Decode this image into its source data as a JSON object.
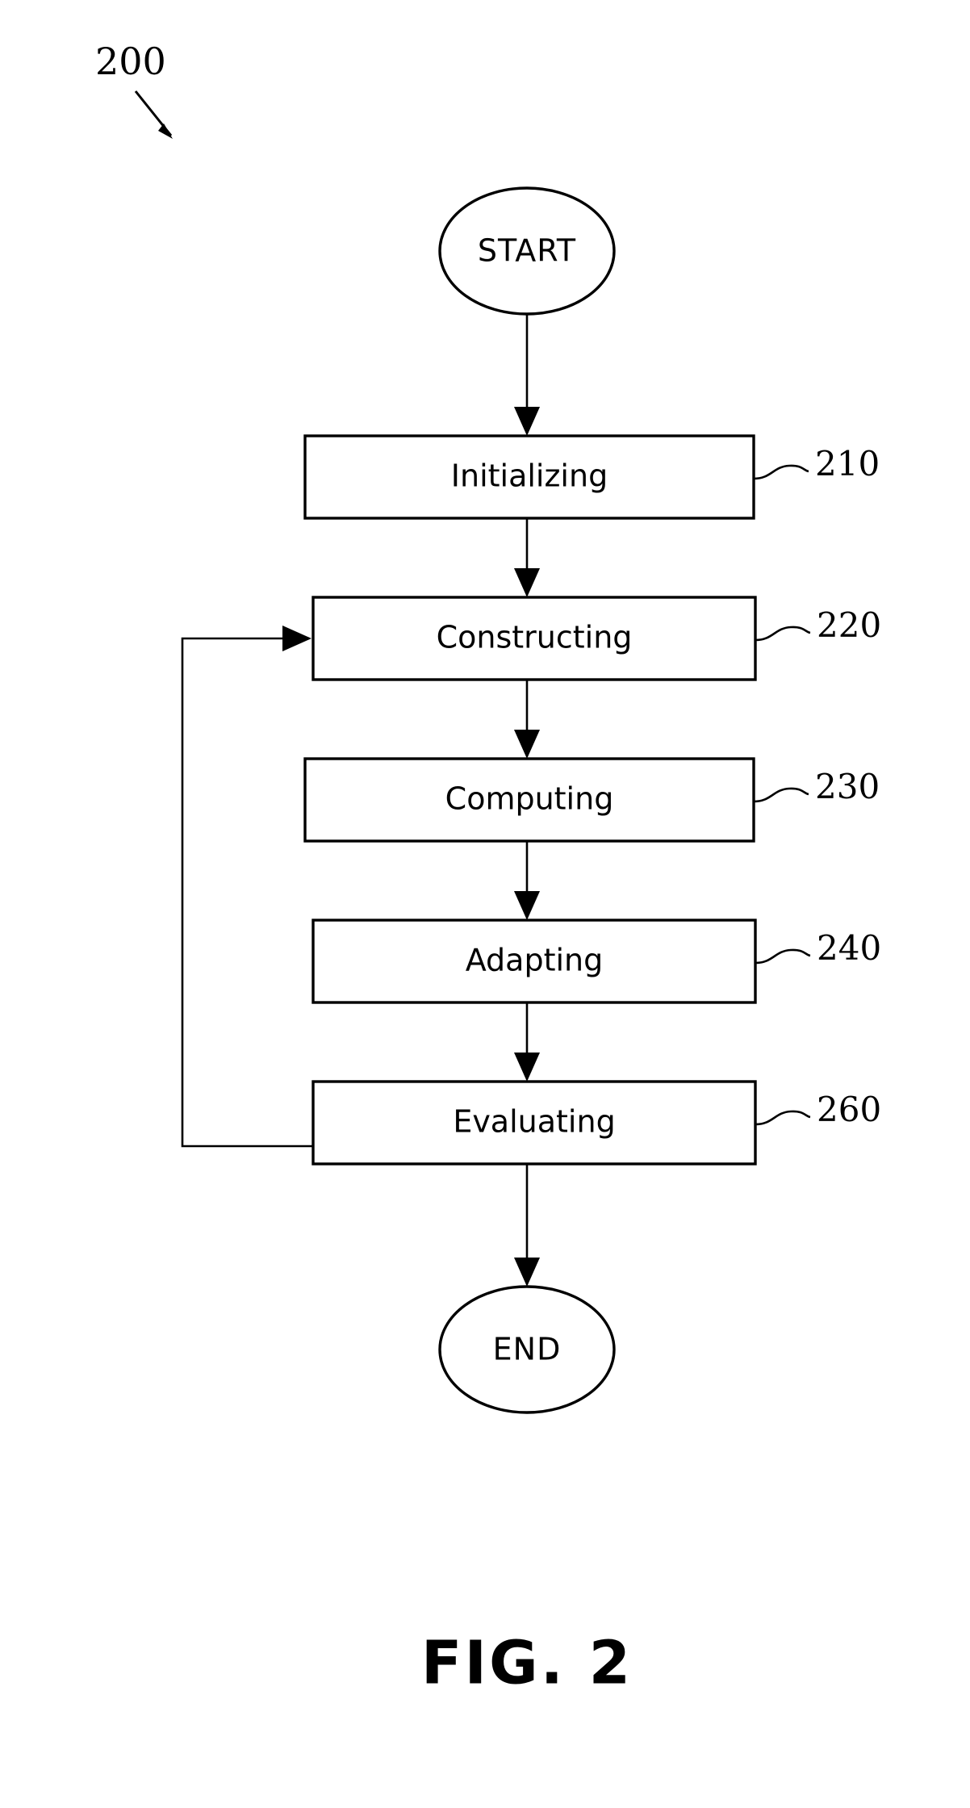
{
  "figure": {
    "caption": "FIG. 2",
    "diagram_label": "200"
  },
  "nodes": {
    "start": {
      "label": "START",
      "shape": "ellipse"
    },
    "end": {
      "label": "END",
      "shape": "ellipse"
    },
    "initializing": {
      "label": "Initializing",
      "ref": "210",
      "shape": "rect"
    },
    "constructing": {
      "label": "Constructing",
      "ref": "220",
      "shape": "rect"
    },
    "computing": {
      "label": "Computing",
      "ref": "230",
      "shape": "rect"
    },
    "adapting": {
      "label": "Adapting",
      "ref": "240",
      "shape": "rect"
    },
    "evaluating": {
      "label": "Evaluating",
      "ref": "260",
      "shape": "rect"
    }
  },
  "edges": [
    {
      "from": "start",
      "to": "initializing",
      "kind": "arrow"
    },
    {
      "from": "initializing",
      "to": "constructing",
      "kind": "arrow"
    },
    {
      "from": "constructing",
      "to": "computing",
      "kind": "arrow"
    },
    {
      "from": "computing",
      "to": "adapting",
      "kind": "arrow"
    },
    {
      "from": "adapting",
      "to": "evaluating",
      "kind": "arrow"
    },
    {
      "from": "evaluating",
      "to": "end",
      "kind": "arrow"
    },
    {
      "from": "evaluating",
      "to": "constructing",
      "kind": "feedback-loop"
    }
  ],
  "colors": {
    "ink": "#000000",
    "paper": "#ffffff"
  }
}
